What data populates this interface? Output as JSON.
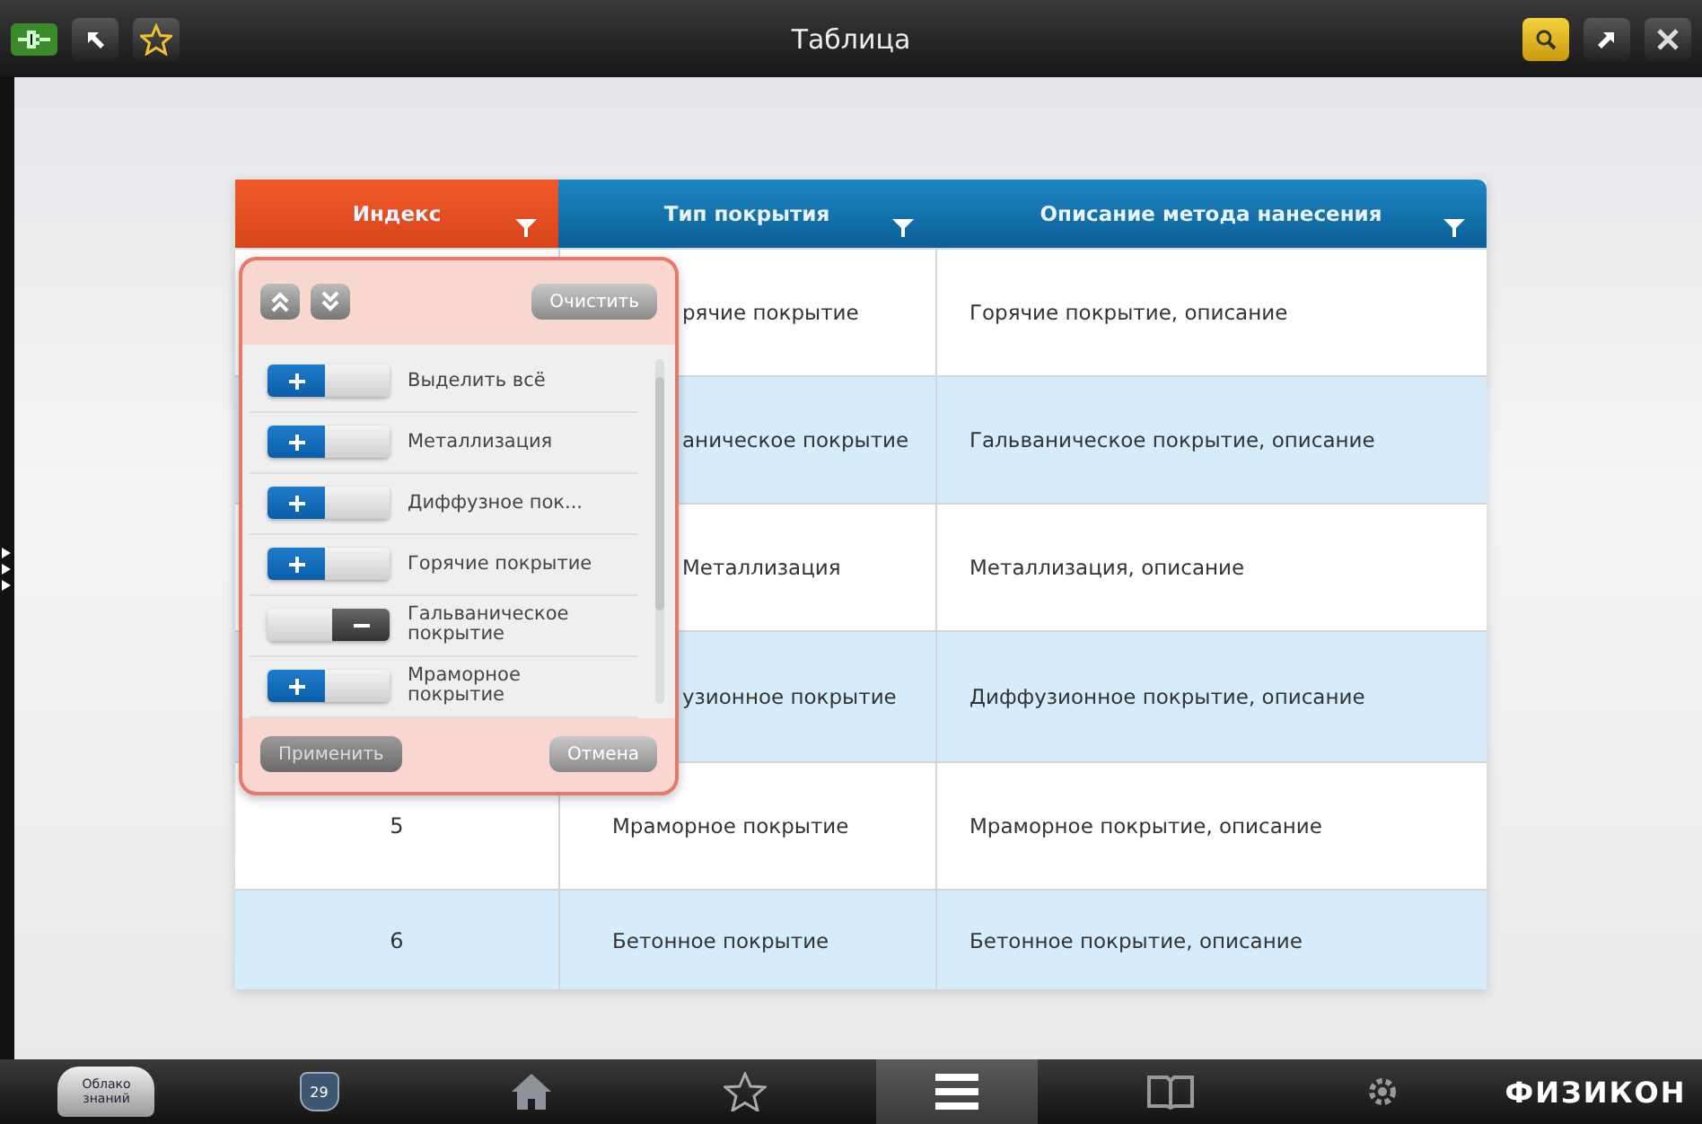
{
  "window": {
    "title": "Таблица"
  },
  "table": {
    "columns": [
      {
        "label": "Индекс",
        "selected": true
      },
      {
        "label": "Тип покрытия",
        "selected": false
      },
      {
        "label": "Описание метода нанесения",
        "selected": false
      }
    ],
    "rows": [
      {
        "index": null,
        "type": "рячие покрытие",
        "description": "Горячие покрытие, описание"
      },
      {
        "index": null,
        "type": "аническое покрытие",
        "description": "Гальваническое покрытие, описание"
      },
      {
        "index": null,
        "type": "Металлизация",
        "description": "Металлизация, описание"
      },
      {
        "index": null,
        "type": "узионное покрытие",
        "description": "Диффузионное покрытие, описание"
      },
      {
        "index": "5",
        "type": "Мраморное покрытие",
        "description": "Мраморное покрытие, описание"
      },
      {
        "index": "6",
        "type": "Бетонное покрытие",
        "description": "Бетонное покрытие, описание"
      }
    ]
  },
  "filter": {
    "clear_button": "Очистить",
    "options": [
      {
        "label": "Выделить всё",
        "on": true
      },
      {
        "label": "Металлизация",
        "on": true
      },
      {
        "label": "Диффузное пок...",
        "on": true
      },
      {
        "label": "Горячие покрытие",
        "on": true
      },
      {
        "label": "Гальваническое покрытие",
        "on": false
      },
      {
        "label": "Мраморное покрытие",
        "on": true
      }
    ],
    "apply_button": {
      "label": "Применить",
      "disabled": true
    },
    "cancel_button": {
      "label": "Отмена",
      "disabled": false
    }
  },
  "bottom_bar": {
    "logo": "Облако знаний",
    "badge": "29",
    "items": [
      {
        "selected": false
      },
      {
        "selected": false
      },
      {
        "selected": true
      },
      {
        "selected": false
      },
      {
        "selected": false
      }
    ],
    "brand": "ФИЗИКОН"
  }
}
